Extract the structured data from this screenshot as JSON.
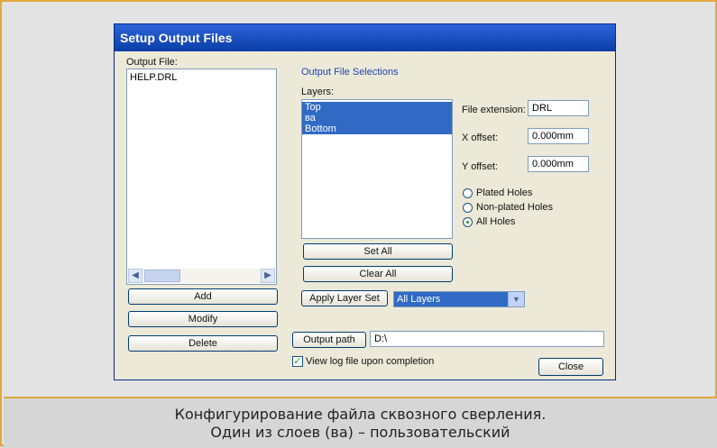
{
  "dialog": {
    "title": "Setup Output Files",
    "output_file_label": "Output File:",
    "output_files": [
      "HELP.DRL"
    ],
    "buttons": {
      "add": "Add",
      "modify": "Modify",
      "delete": "Delete"
    },
    "selections_group_label": "Output File Selections",
    "layers_label": "Layers:",
    "layers": [
      {
        "name": "Top",
        "selected": true
      },
      {
        "name": "ва",
        "selected": true
      },
      {
        "name": "Bottom",
        "selected": true
      }
    ],
    "set_all": "Set All",
    "clear_all": "Clear All",
    "apply_layer_set": "Apply Layer Set",
    "layer_set_selected": "All Layers",
    "file_extension_label": "File extension:",
    "file_extension_value": "DRL",
    "x_offset_label": "X offset:",
    "x_offset_value": "0.000mm",
    "y_offset_label": "Y offset:",
    "y_offset_value": "0.000mm",
    "holes_options": [
      {
        "label": "Plated Holes",
        "checked": false
      },
      {
        "label": "Non-plated Holes",
        "checked": false
      },
      {
        "label": "All Holes",
        "checked": true
      }
    ],
    "output_path_button": "Output path",
    "output_path_value": "D:\\",
    "view_log_label": "View log file upon completion",
    "view_log_checked": true,
    "close": "Close"
  },
  "caption": {
    "line1": "Конфигурирование файла сквозного сверления.",
    "line2": "Один из слоев (ва) – пользовательский"
  },
  "colors": {
    "frame_border": "#e0a93a",
    "titlebar": "#0b3ea8",
    "selection": "#316ac5"
  }
}
